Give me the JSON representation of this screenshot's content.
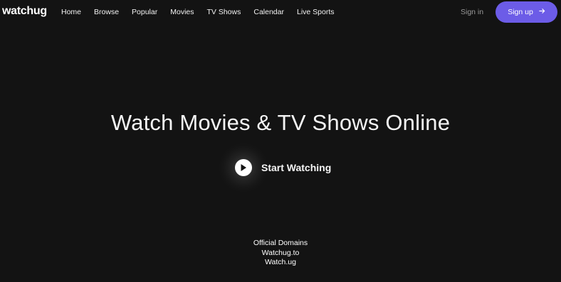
{
  "brand": {
    "logo_text": "watchug"
  },
  "nav": {
    "items": [
      {
        "label": "Home"
      },
      {
        "label": "Browse"
      },
      {
        "label": "Popular"
      },
      {
        "label": "Movies"
      },
      {
        "label": "TV Shows"
      },
      {
        "label": "Calendar"
      },
      {
        "label": "Live Sports"
      }
    ]
  },
  "auth": {
    "signin_label": "Sign in",
    "signup_label": "Sign up",
    "signup_icon": "arrow-right-icon"
  },
  "hero": {
    "title": "Watch Movies & TV Shows Online",
    "cta_label": "Start Watching",
    "cta_icon": "play-icon"
  },
  "domains": {
    "heading": "Official Domains",
    "items": [
      "Watchug.to",
      "Watch.ug"
    ]
  },
  "colors": {
    "background": "#131313",
    "accent": "#6c5ce7",
    "muted_text": "#9a9a9a"
  }
}
